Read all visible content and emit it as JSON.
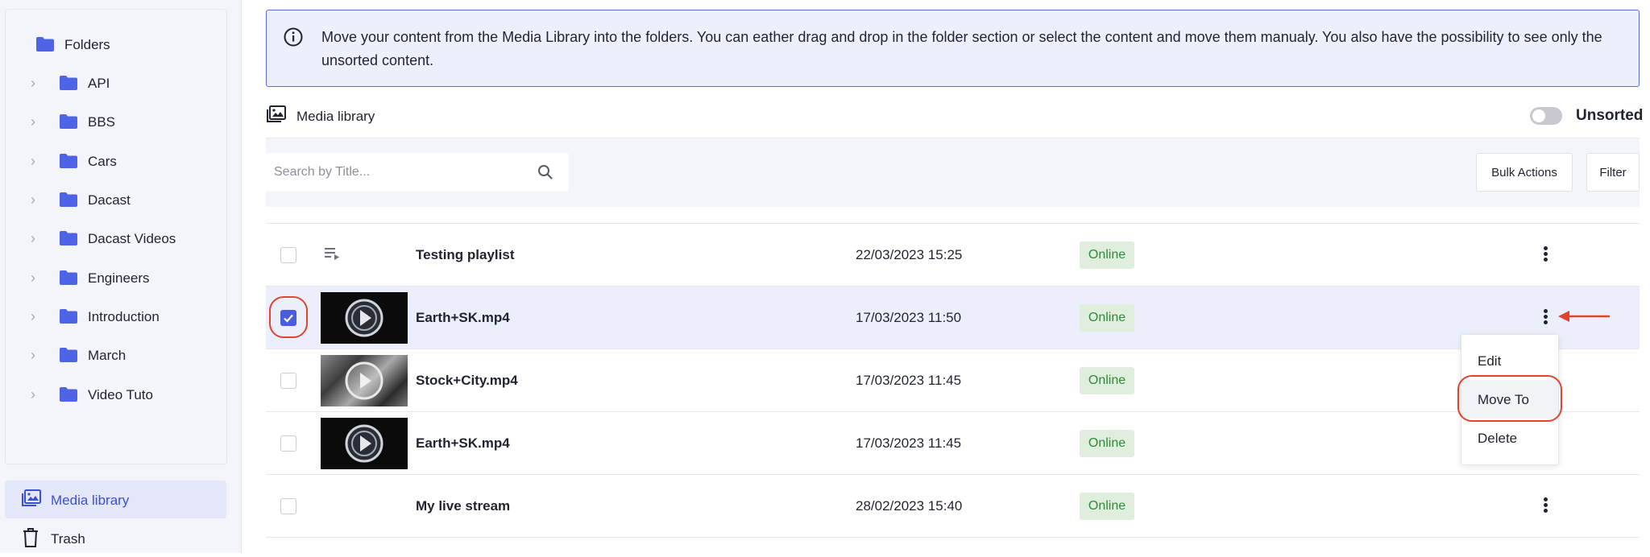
{
  "sidebar": {
    "folders_root": "Folders",
    "folders": [
      {
        "label": "API"
      },
      {
        "label": "BBS"
      },
      {
        "label": "Cars"
      },
      {
        "label": "Dacast"
      },
      {
        "label": "Dacast Videos"
      },
      {
        "label": "Engineers"
      },
      {
        "label": "Introduction"
      },
      {
        "label": "March"
      },
      {
        "label": "Video Tuto"
      }
    ],
    "nav": {
      "media_library": "Media library",
      "trash": "Trash"
    }
  },
  "banner": {
    "text": "Move your content from the Media Library into the folders. You can eather drag and drop in the folder section or select the content and move them manualy. You also have the possibility to see only the unsorted content."
  },
  "header": {
    "title": "Media library",
    "unsorted_label": "Unsorted",
    "unsorted_on": false
  },
  "toolbar": {
    "search_placeholder": "Search by Title...",
    "bulk_actions": "Bulk Actions",
    "filter": "Filter"
  },
  "rows": [
    {
      "title": "Testing playlist",
      "date": "22/03/2023 15:25",
      "status": "Online",
      "type": "playlist",
      "checked": false
    },
    {
      "title": "Earth+SK.mp4",
      "date": "17/03/2023 11:50",
      "status": "Online",
      "type": "video-dark",
      "checked": true
    },
    {
      "title": "Stock+City.mp4",
      "date": "17/03/2023 11:45",
      "status": "Online",
      "type": "video-city",
      "checked": false
    },
    {
      "title": "Earth+SK.mp4",
      "date": "17/03/2023 11:45",
      "status": "Online",
      "type": "video-dark",
      "checked": false
    },
    {
      "title": "My live stream",
      "date": "28/02/2023 15:40",
      "status": "Online",
      "type": "live",
      "checked": false
    }
  ],
  "context_menu": {
    "items": [
      "Edit",
      "Move To",
      "Delete"
    ],
    "highlighted": "Move To"
  },
  "colors": {
    "accent": "#4a5bdc",
    "folder_icon": "#4f63e6",
    "status_bg": "#dfeedd",
    "status_text": "#2f8a38",
    "annotation": "#e0442e"
  }
}
